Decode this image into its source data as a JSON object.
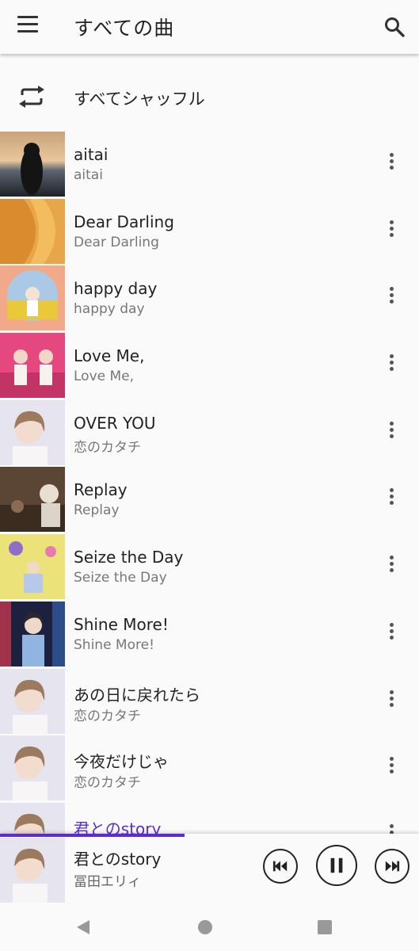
{
  "appbar": {
    "title": "すべての曲",
    "menu_icon": "menu-icon",
    "search_icon": "search-icon"
  },
  "shuffle": {
    "label": "すべてシャッフル",
    "icon": "repeat-shuffle-icon"
  },
  "songs": [
    {
      "title": "aitai",
      "subtitle": "aitai"
    },
    {
      "title": "Dear Darling",
      "subtitle": "Dear Darling"
    },
    {
      "title": "happy day",
      "subtitle": "happy day"
    },
    {
      "title": "Love Me,",
      "subtitle": "Love Me,"
    },
    {
      "title": "OVER YOU",
      "subtitle": "恋のカタチ"
    },
    {
      "title": "Replay",
      "subtitle": "Replay"
    },
    {
      "title": "Seize the Day",
      "subtitle": "Seize the Day"
    },
    {
      "title": "Shine More!",
      "subtitle": "Shine More!"
    },
    {
      "title": "あの日に戻れたら",
      "subtitle": "恋のカタチ"
    },
    {
      "title": "今夜だけじゃ",
      "subtitle": "恋のカタチ"
    },
    {
      "title": "君とのstory",
      "subtitle": ""
    }
  ],
  "player": {
    "title": "君とのstory",
    "artist": "冨田エリィ",
    "progress_fraction": 0.44
  },
  "colors": {
    "accent": "#5b2bd6",
    "background": "#fafafa"
  }
}
